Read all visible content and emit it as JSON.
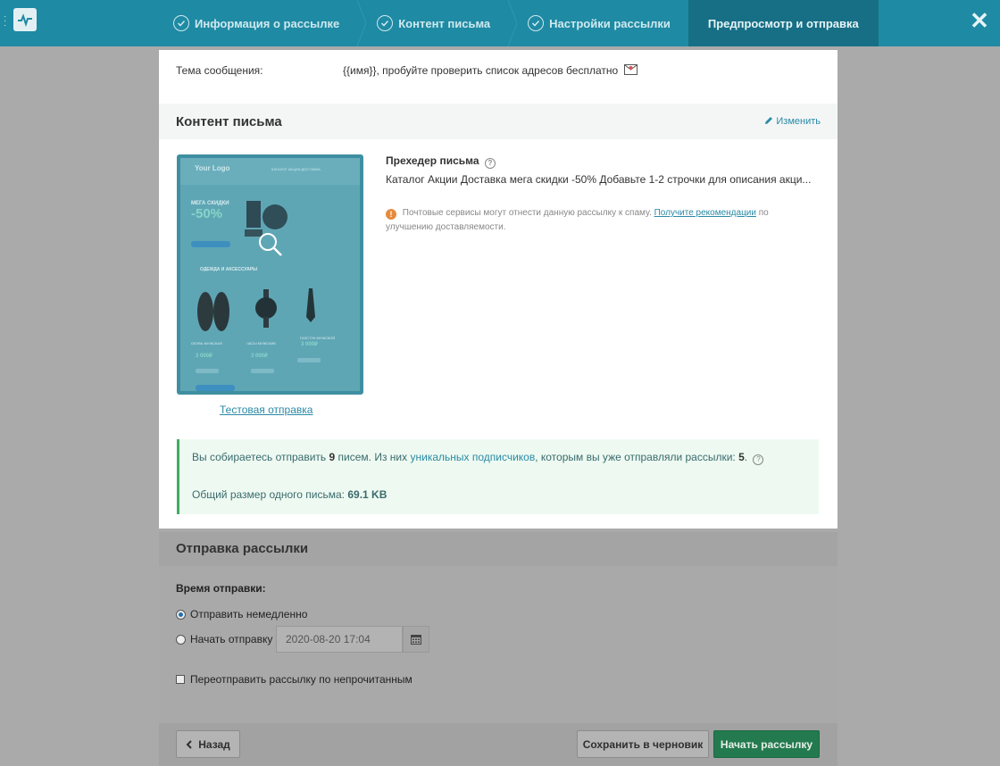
{
  "topbar": {
    "steps": [
      {
        "label": "Информация о рассылке"
      },
      {
        "label": "Контент письма"
      },
      {
        "label": "Настройки рассылки"
      },
      {
        "label": "Предпросмотр и отправка"
      }
    ],
    "close_glyph": "✕"
  },
  "subject": {
    "label": "Тема сообщения:",
    "value": "{{имя}}, пробуйте проверить список адресов бесплатно"
  },
  "content": {
    "title": "Контент письма",
    "edit_label": "Изменить",
    "test_send_label": "Тестовая отправка",
    "preheader_title": "Прехедер письма",
    "preheader_text": "Каталог Акции Доставка мега скидки -50% Добавьте 1-2 строчки для описания акци...",
    "warning_text": "Почтовые сервисы могут отнести данную рассылку к спаму.",
    "warning_link": "Получите рекомендации",
    "warning_tail": "по",
    "warning_line2": "улучшению доставляемости."
  },
  "thumbnail": {
    "logo_text": "Your Logo",
    "nav_text": "КАТАЛОГ АКЦИИ ДОСТАВКА",
    "promo_title": "МЕГА СКИДКИ",
    "promo_value": "-50%",
    "section_title": "ОДЕЖДА И АКСЕССУАРЫ",
    "products": [
      {
        "name": "ОБУВЬ МУЖСКАЯ",
        "price": "3 000₽"
      },
      {
        "name": "ЧАСЫ МУЖСКИЕ",
        "price": "3 000₽"
      },
      {
        "name": "ГАЛСТУК МУЖСКОЙ",
        "price": "3 000₽"
      }
    ]
  },
  "summary": {
    "line1_pre": "Вы собираетесь отправить",
    "letters_count": "9",
    "line1_mid": "писем.  Из них",
    "unique_link": "уникальных подписчиков",
    "line1_post": ", которым вы уже отправляли рассылки:",
    "sent_count": "5",
    "line2_pre": "Общий размер одного письма:",
    "size": "69.1 KB"
  },
  "sending": {
    "title": "Отправка рассылки",
    "time_label": "Время отправки:",
    "send_now_label": "Отправить немедленно",
    "schedule_label": "Начать отправку",
    "date_value": "2020-08-20 17:04",
    "resend_label": "Переотправить рассылку по непрочитанным"
  },
  "footer": {
    "back_label": "Назад",
    "draft_label": "Сохранить в черновик",
    "start_label": "Начать рассылку"
  },
  "colors": {
    "topbar": "#1f8aa3",
    "accent_link": "#2a8aa5",
    "success_border": "#3fae63",
    "start_button": "#237a4f"
  }
}
